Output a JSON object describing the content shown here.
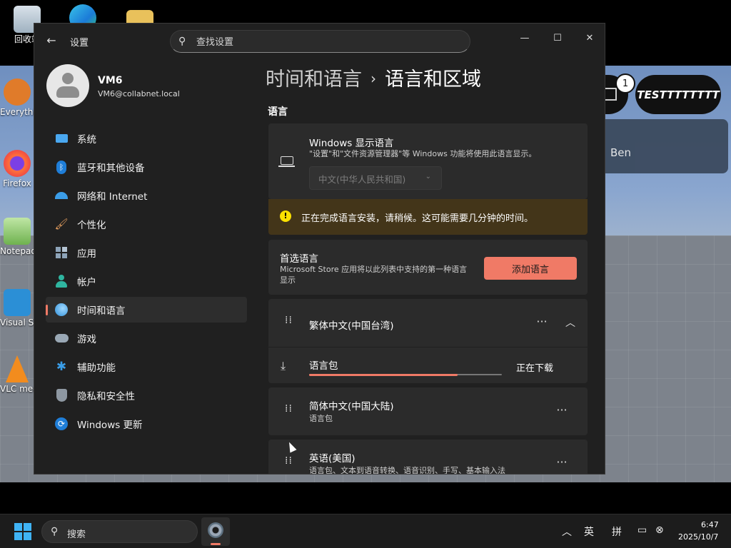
{
  "desktop": {
    "icons": [
      {
        "label": "回收站"
      },
      {
        "label": "Everything"
      },
      {
        "label": "Firefox"
      },
      {
        "label": "Notepad++"
      },
      {
        "label": "Visual Studio"
      },
      {
        "label": "VLC media player"
      }
    ],
    "overlay": {
      "notification_count": "1",
      "test_button": "TESTTTTTTTT",
      "user_name": "Ben"
    }
  },
  "window": {
    "app_title": "设置",
    "search_placeholder": "查找设置",
    "controls": {
      "minimize": "—",
      "maximize": "☐",
      "close": "✕"
    }
  },
  "profile": {
    "name": "VM6",
    "email": "VM6@collabnet.local"
  },
  "sidebar": {
    "items": [
      {
        "label": "系统",
        "icon": "monitor-icon",
        "active": false
      },
      {
        "label": "蓝牙和其他设备",
        "icon": "bluetooth-icon",
        "active": false
      },
      {
        "label": "网络和 Internet",
        "icon": "wifi-icon",
        "active": false
      },
      {
        "label": "个性化",
        "icon": "paintbrush-icon",
        "active": false
      },
      {
        "label": "应用",
        "icon": "apps-icon",
        "active": false
      },
      {
        "label": "帐户",
        "icon": "person-icon",
        "active": false
      },
      {
        "label": "时间和语言",
        "icon": "globe-clock-icon",
        "active": true
      },
      {
        "label": "游戏",
        "icon": "gamepad-icon",
        "active": false
      },
      {
        "label": "辅助功能",
        "icon": "accessibility-icon",
        "active": false
      },
      {
        "label": "隐私和安全性",
        "icon": "shield-icon",
        "active": false
      },
      {
        "label": "Windows 更新",
        "icon": "update-icon",
        "active": false
      }
    ]
  },
  "main": {
    "breadcrumb": {
      "parent": "时间和语言",
      "separator": "›",
      "current": "语言和区域"
    },
    "section_title": "语言",
    "display_language": {
      "title": "Windows 显示语言",
      "description": "\"设置\"和\"文件资源管理器\"等 Windows 功能将使用此语言显示。",
      "selected": "中文(中华人民共和国)"
    },
    "warning": "正在完成语言安装，请稍候。这可能需要几分钟的时间。",
    "preferred": {
      "title": "首选语言",
      "description": "Microsoft Store 应用将以此列表中支持的第一种语言显示",
      "add_button": "添加语言"
    },
    "languages": [
      {
        "name": "繁体中文(中国台湾)",
        "pack_label": "语言包",
        "status": "正在下载",
        "progress": 0.77,
        "expanded": true
      },
      {
        "name": "简体中文(中国大陆)",
        "sub": "语言包"
      },
      {
        "name": "英语(美国)",
        "sub": "语言包、文本到语音转换、语音识别、手写、基本输入法"
      }
    ]
  },
  "taskbar": {
    "search_label": "搜索",
    "tray": {
      "ime_lang": "英",
      "ime_mode": "拼"
    },
    "time": "6:47",
    "date": "2025/10/7"
  },
  "colors": {
    "accent": "#f07a66",
    "window_bg": "#202020",
    "card_bg": "#2b2b2b",
    "warning_bg": "#433519"
  }
}
